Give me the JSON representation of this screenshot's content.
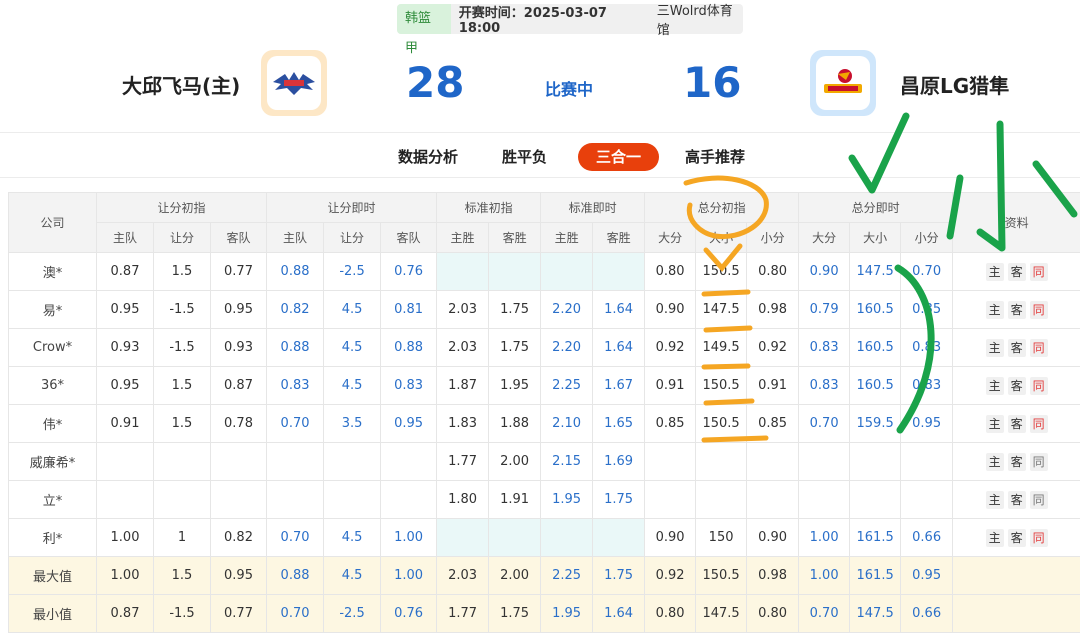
{
  "header": {
    "league": "韩篮甲",
    "start_time": "开赛时间：2025-03-07 18:00",
    "venue": "三Wolrd体育馆",
    "home_name": "大邱飞马(主)",
    "away_name": "昌原LG猎隼",
    "home_score": "28",
    "away_score": "16",
    "status": "比赛中"
  },
  "tabs": [
    "数据分析",
    "胜平负",
    "三合一",
    "高手推荐"
  ],
  "table": {
    "group_headers": [
      "公司",
      "让分初指",
      "让分即时",
      "标准初指",
      "标准即时",
      "总分初指",
      "总分即时",
      "资料"
    ],
    "sub_headers": [
      "主队",
      "让分",
      "客队",
      "主队",
      "让分",
      "客队",
      "主胜",
      "客胜",
      "主胜",
      "客胜",
      "大分",
      "大小",
      "小分",
      "大分",
      "大小",
      "小分"
    ],
    "rows": [
      {
        "company": "澳*",
        "cells": [
          "0.87",
          "1.5",
          "0.77",
          "0.88",
          "-2.5",
          "0.76",
          "",
          "",
          "",
          "",
          "0.80",
          "150.5",
          "0.80",
          "0.90",
          "147.5",
          "0.70"
        ],
        "btn_red": true
      },
      {
        "company": "易*",
        "cells": [
          "0.95",
          "-1.5",
          "0.95",
          "0.82",
          "4.5",
          "0.81",
          "2.03",
          "1.75",
          "2.20",
          "1.64",
          "0.90",
          "147.5",
          "0.98",
          "0.79",
          "160.5",
          "0.85"
        ],
        "btn_red": true
      },
      {
        "company": "Crow*",
        "cells": [
          "0.93",
          "-1.5",
          "0.93",
          "0.88",
          "4.5",
          "0.88",
          "2.03",
          "1.75",
          "2.20",
          "1.64",
          "0.92",
          "149.5",
          "0.92",
          "0.83",
          "160.5",
          "0.83"
        ],
        "btn_red": true
      },
      {
        "company": "36*",
        "cells": [
          "0.95",
          "1.5",
          "0.87",
          "0.83",
          "4.5",
          "0.83",
          "1.87",
          "1.95",
          "2.25",
          "1.67",
          "0.91",
          "150.5",
          "0.91",
          "0.83",
          "160.5",
          "0.83"
        ],
        "btn_red": true
      },
      {
        "company": "伟*",
        "cells": [
          "0.91",
          "1.5",
          "0.78",
          "0.70",
          "3.5",
          "0.95",
          "1.83",
          "1.88",
          "2.10",
          "1.65",
          "0.85",
          "150.5",
          "0.85",
          "0.70",
          "159.5",
          "0.95"
        ],
        "btn_red": true
      },
      {
        "company": "威廉希*",
        "cells": [
          "",
          "",
          "",
          "",
          "",
          "",
          "1.77",
          "2.00",
          "2.15",
          "1.69",
          "",
          "",
          "",
          "",
          "",
          ""
        ],
        "btn_red": false
      },
      {
        "company": "立*",
        "cells": [
          "",
          "",
          "",
          "",
          "",
          "",
          "1.80",
          "1.91",
          "1.95",
          "1.75",
          "",
          "",
          "",
          "",
          "",
          ""
        ],
        "btn_red": false
      },
      {
        "company": "利*",
        "cells": [
          "1.00",
          "1",
          "0.82",
          "0.70",
          "4.5",
          "1.00",
          "",
          "",
          "",
          "",
          "0.90",
          "150",
          "0.90",
          "1.00",
          "161.5",
          "0.66"
        ],
        "btn_red": true
      }
    ],
    "summary": [
      {
        "company": "最大值",
        "cells": [
          "1.00",
          "1.5",
          "0.95",
          "0.88",
          "4.5",
          "1.00",
          "2.03",
          "2.00",
          "2.25",
          "1.75",
          "0.92",
          "150.5",
          "0.98",
          "1.00",
          "161.5",
          "0.95"
        ]
      },
      {
        "company": "最小值",
        "cells": [
          "0.87",
          "-1.5",
          "0.77",
          "0.70",
          "-2.5",
          "0.76",
          "1.77",
          "1.75",
          "1.95",
          "1.64",
          "0.80",
          "147.5",
          "0.80",
          "0.70",
          "147.5",
          "0.66"
        ]
      }
    ],
    "btn_labels": [
      "主",
      "客",
      "同"
    ]
  },
  "annotations": {
    "chinese_char": "小",
    "colors": {
      "orange": "#f5a623",
      "green": "#1aa34a"
    }
  }
}
